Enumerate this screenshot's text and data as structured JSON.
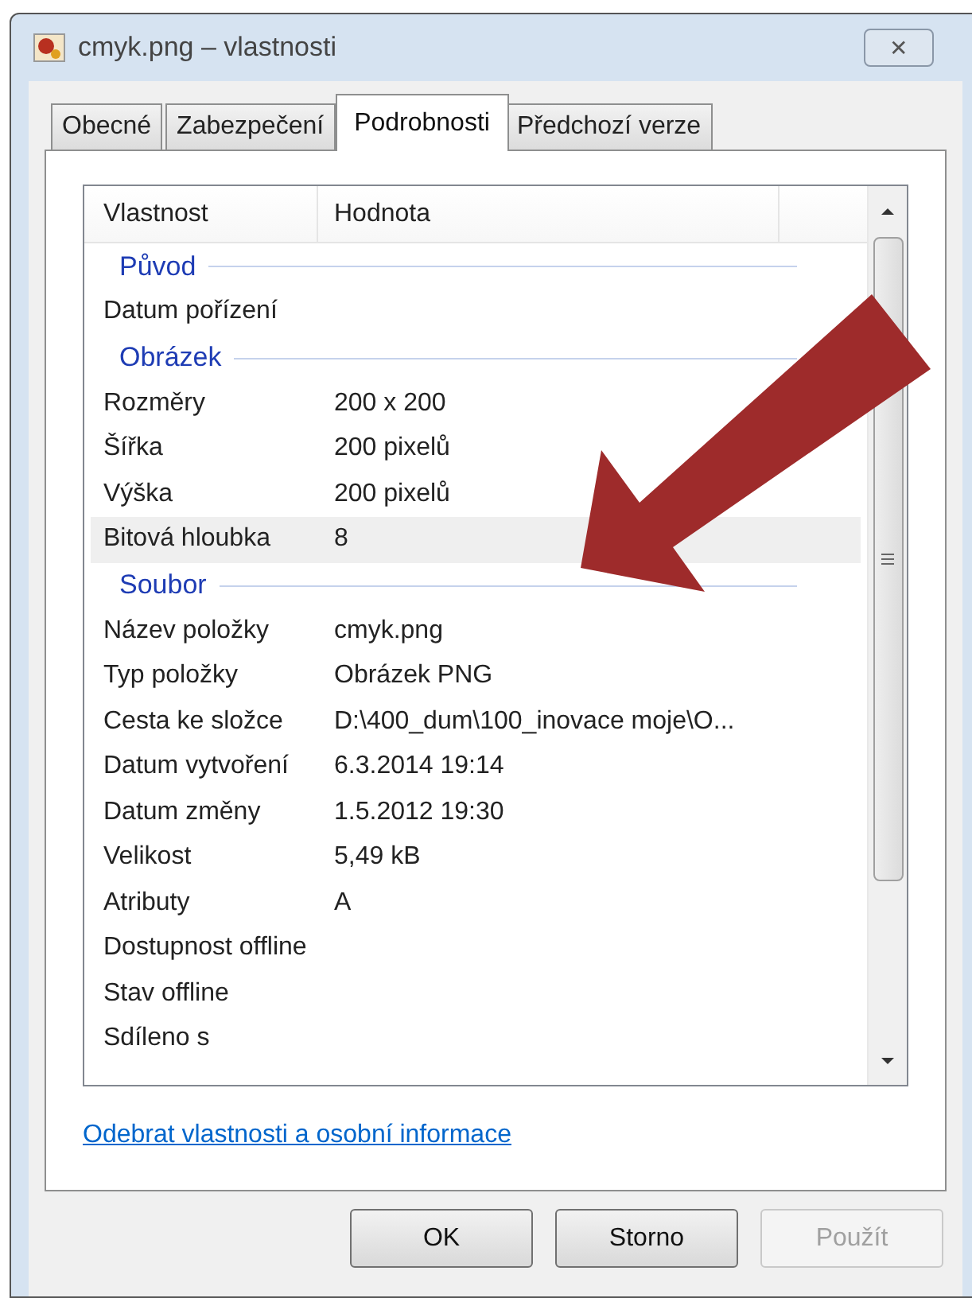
{
  "window": {
    "title": "cmyk.png – vlastnosti",
    "close": "✕"
  },
  "tabs": [
    {
      "label": "Obecné",
      "selected": false
    },
    {
      "label": "Zabezpečení",
      "selected": false
    },
    {
      "label": "Podrobnosti",
      "selected": true
    },
    {
      "label": "Předchozí verze",
      "selected": false
    }
  ],
  "table": {
    "columns": [
      "Vlastnost",
      "Hodnota"
    ],
    "rows": [
      {
        "kind": "group",
        "label": "Původ"
      },
      {
        "kind": "property",
        "name": "Datum pořízení",
        "value": "",
        "selected": false
      },
      {
        "kind": "group",
        "label": "Obrázek"
      },
      {
        "kind": "property",
        "name": "Rozměry",
        "value": "200 x 200",
        "selected": false
      },
      {
        "kind": "property",
        "name": "Šířka",
        "value": "200 pixelů",
        "selected": false
      },
      {
        "kind": "property",
        "name": "Výška",
        "value": "200 pixelů",
        "selected": false
      },
      {
        "kind": "property",
        "name": "Bitová hloubka",
        "value": "8",
        "selected": true
      },
      {
        "kind": "group",
        "label": "Soubor"
      },
      {
        "kind": "property",
        "name": "Název položky",
        "value": "cmyk.png",
        "selected": false
      },
      {
        "kind": "property",
        "name": "Typ položky",
        "value": "Obrázek PNG",
        "selected": false
      },
      {
        "kind": "property",
        "name": "Cesta ke složce",
        "value": "D:\\400_dum\\100_inovace moje\\O...",
        "selected": false
      },
      {
        "kind": "property",
        "name": "Datum vytvoření",
        "value": "6.3.2014 19:14",
        "selected": false
      },
      {
        "kind": "property",
        "name": "Datum změny",
        "value": "1.5.2012 19:30",
        "selected": false
      },
      {
        "kind": "property",
        "name": "Velikost",
        "value": "5,49 kB",
        "selected": false
      },
      {
        "kind": "property",
        "name": "Atributy",
        "value": "A",
        "selected": false
      },
      {
        "kind": "property",
        "name": "Dostupnost offline",
        "value": "",
        "selected": false
      },
      {
        "kind": "property",
        "name": "Stav offline",
        "value": "",
        "selected": false
      },
      {
        "kind": "property",
        "name": "Sdíleno s",
        "value": "",
        "selected": false
      }
    ]
  },
  "link": "Odebrat vlastnosti a osobní informace",
  "buttons": [
    {
      "label": "OK",
      "disabled": false
    },
    {
      "label": "Storno",
      "disabled": false
    },
    {
      "label": "Použít",
      "disabled": true
    }
  ]
}
